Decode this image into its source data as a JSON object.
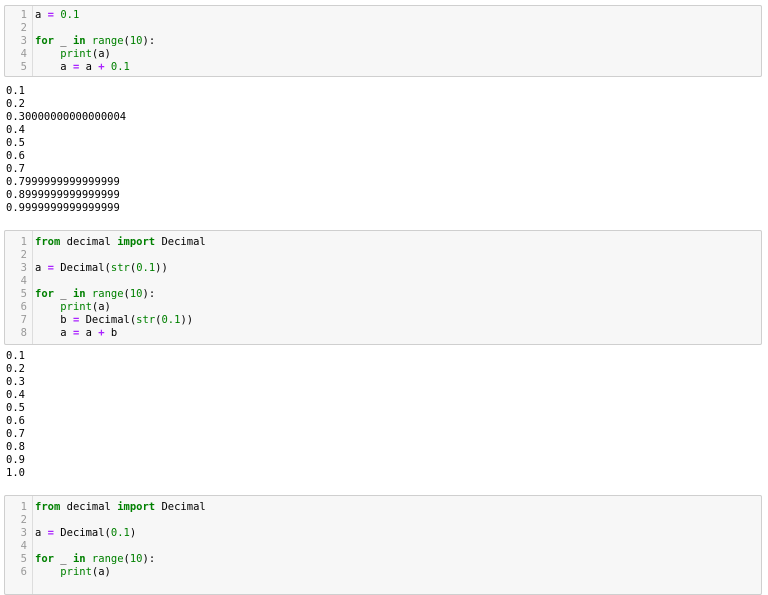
{
  "cells": [
    {
      "lines": [
        {
          "n": "1",
          "tokens": [
            [
              "a ",
              ""
            ],
            [
              "=",
              "op"
            ],
            [
              " ",
              ""
            ],
            [
              "0.1",
              "num"
            ]
          ]
        },
        {
          "n": "2",
          "tokens": []
        },
        {
          "n": "3",
          "tokens": [
            [
              "for",
              "kw"
            ],
            [
              " _ ",
              ""
            ],
            [
              "in",
              "kw"
            ],
            [
              " ",
              ""
            ],
            [
              "range",
              "builtin"
            ],
            [
              "(",
              ""
            ],
            [
              "10",
              "num"
            ],
            [
              "):",
              ""
            ]
          ]
        },
        {
          "n": "4",
          "tokens": [
            [
              "    ",
              ""
            ],
            [
              "print",
              "builtin"
            ],
            [
              "(a)",
              ""
            ]
          ]
        },
        {
          "n": "5",
          "tokens": [
            [
              "    a ",
              ""
            ],
            [
              "=",
              "op"
            ],
            [
              " a ",
              ""
            ],
            [
              "+",
              "op"
            ],
            [
              " ",
              ""
            ],
            [
              "0.1",
              "num"
            ]
          ]
        }
      ],
      "output": [
        "0.1",
        "0.2",
        "0.30000000000000004",
        "0.4",
        "0.5",
        "0.6",
        "0.7",
        "0.7999999999999999",
        "0.8999999999999999",
        "0.9999999999999999"
      ]
    },
    {
      "lines": [
        {
          "n": "1",
          "tokens": [
            [
              "from",
              "kw"
            ],
            [
              " decimal ",
              ""
            ],
            [
              "import",
              "kw"
            ],
            [
              " Decimal",
              ""
            ]
          ]
        },
        {
          "n": "2",
          "tokens": []
        },
        {
          "n": "3",
          "tokens": [
            [
              "a ",
              ""
            ],
            [
              "=",
              "op"
            ],
            [
              " Decimal(",
              ""
            ],
            [
              "str",
              "builtin"
            ],
            [
              "(",
              ""
            ],
            [
              "0.1",
              "num"
            ],
            [
              "))",
              ""
            ]
          ]
        },
        {
          "n": "4",
          "tokens": []
        },
        {
          "n": "5",
          "tokens": [
            [
              "for",
              "kw"
            ],
            [
              " _ ",
              ""
            ],
            [
              "in",
              "kw"
            ],
            [
              " ",
              ""
            ],
            [
              "range",
              "builtin"
            ],
            [
              "(",
              ""
            ],
            [
              "10",
              "num"
            ],
            [
              "):",
              ""
            ]
          ]
        },
        {
          "n": "6",
          "tokens": [
            [
              "    ",
              ""
            ],
            [
              "print",
              "builtin"
            ],
            [
              "(a)",
              ""
            ]
          ]
        },
        {
          "n": "7",
          "tokens": [
            [
              "    b ",
              ""
            ],
            [
              "=",
              "op"
            ],
            [
              " Decimal(",
              ""
            ],
            [
              "str",
              "builtin"
            ],
            [
              "(",
              ""
            ],
            [
              "0.1",
              "num"
            ],
            [
              "))",
              ""
            ]
          ]
        },
        {
          "n": "8",
          "tokens": [
            [
              "    a ",
              ""
            ],
            [
              "=",
              "op"
            ],
            [
              " a ",
              ""
            ],
            [
              "+",
              "op"
            ],
            [
              " b",
              ""
            ]
          ]
        }
      ],
      "output": [
        "0.1",
        "0.2",
        "0.3",
        "0.4",
        "0.5",
        "0.6",
        "0.7",
        "0.8",
        "0.9",
        "1.0"
      ]
    },
    {
      "lines": [
        {
          "n": "1",
          "tokens": [
            [
              "from",
              "kw"
            ],
            [
              " decimal ",
              ""
            ],
            [
              "import",
              "kw"
            ],
            [
              " Decimal",
              ""
            ]
          ]
        },
        {
          "n": "2",
          "tokens": []
        },
        {
          "n": "3",
          "tokens": [
            [
              "a ",
              ""
            ],
            [
              "=",
              "op"
            ],
            [
              " Decimal(",
              ""
            ],
            [
              "0.1",
              "num"
            ],
            [
              ")",
              ""
            ]
          ]
        },
        {
          "n": "4",
          "tokens": []
        },
        {
          "n": "5",
          "tokens": [
            [
              "for",
              "kw"
            ],
            [
              " _ ",
              ""
            ],
            [
              "in",
              "kw"
            ],
            [
              " ",
              ""
            ],
            [
              "range",
              "builtin"
            ],
            [
              "(",
              ""
            ],
            [
              "10",
              "num"
            ],
            [
              "):",
              ""
            ]
          ]
        },
        {
          "n": "6",
          "tokens": [
            [
              "    ",
              ""
            ],
            [
              "print",
              "builtin"
            ],
            [
              "(a)",
              ""
            ]
          ]
        }
      ],
      "output": []
    }
  ]
}
